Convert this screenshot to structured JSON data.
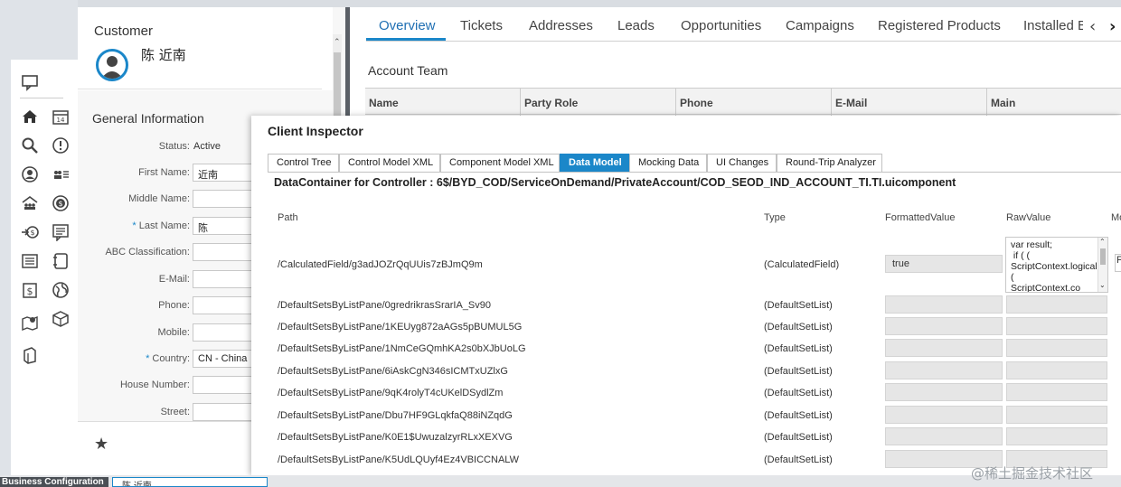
{
  "customer": {
    "title": "Customer",
    "name": "陈 近南",
    "general_info_title": "General Information",
    "status_label": "Status:",
    "status_value": "Active",
    "fields": [
      {
        "label": "First Name:",
        "value": "近南",
        "required": false
      },
      {
        "label": "Middle Name:",
        "value": "",
        "required": false
      },
      {
        "label": "Last Name:",
        "value": "陈",
        "required": true
      },
      {
        "label": "ABC Classification:",
        "value": "",
        "required": false
      },
      {
        "label": "E-Mail:",
        "value": "",
        "required": false
      },
      {
        "label": "Phone:",
        "value": "",
        "required": false
      },
      {
        "label": "Mobile:",
        "value": "",
        "required": false
      },
      {
        "label": "Country:",
        "value": "CN - China",
        "required": true
      },
      {
        "label": "House Number:",
        "value": "",
        "required": false
      },
      {
        "label": "Street:",
        "value": "",
        "required": false
      }
    ],
    "required_marker": "*",
    "favorite_icon": "★"
  },
  "tabs": [
    "Overview",
    "Tickets",
    "Addresses",
    "Leads",
    "Opportunities",
    "Campaigns",
    "Registered Products",
    "Installed B"
  ],
  "tab_nav": {
    "prev": "‹",
    "next": "›"
  },
  "account_team": {
    "title": "Account Team",
    "columns": [
      "Name",
      "Party Role",
      "Phone",
      "E-Mail",
      "Main"
    ]
  },
  "inspector": {
    "title": "Client Inspector",
    "tabs": [
      "Control Tree",
      "Control Model XML",
      "Component Model XML",
      "Data Model",
      "Mocking Data",
      "UI Changes",
      "Round-Trip Analyzer"
    ],
    "active_tab": "Data Model",
    "data_container_title": "DataContainer for Controller : 6$/BYD_COD/ServiceOnDemand/PrivateAccount/COD_SEOD_IND_ACCOUNT_TI.TI.uicomponent",
    "columns": [
      "Path",
      "Type",
      "FormattedValue",
      "RawValue",
      "Mo"
    ],
    "rows": [
      {
        "path": "/CalculatedField/g3adJOZrQqUUis7zBJmQ9m",
        "type": "(CalculatedField)",
        "formatted": "true",
        "raw": "var result;\n if ( (\nScriptContext.logicalOr( (\nScriptContext.co"
      },
      {
        "path": "/DefaultSetsByListPane/0gredrikrasSrarIA_Sv90",
        "type": "(DefaultSetList)",
        "formatted": "",
        "raw": ""
      },
      {
        "path": "/DefaultSetsByListPane/1KEUyg872aAGs5pBUMUL5G",
        "type": "(DefaultSetList)",
        "formatted": "",
        "raw": ""
      },
      {
        "path": "/DefaultSetsByListPane/1NmCeGQmhKA2s0bXJbUoLG",
        "type": "(DefaultSetList)",
        "formatted": "",
        "raw": ""
      },
      {
        "path": "/DefaultSetsByListPane/6iAskCgN346sICMTxUZlxG",
        "type": "(DefaultSetList)",
        "formatted": "",
        "raw": ""
      },
      {
        "path": "/DefaultSetsByListPane/9qK4rolyT4cUKelDSydlZm",
        "type": "(DefaultSetList)",
        "formatted": "",
        "raw": ""
      },
      {
        "path": "/DefaultSetsByListPane/Dbu7HF9GLqkfaQ88iNZqdG",
        "type": "(DefaultSetList)",
        "formatted": "",
        "raw": ""
      },
      {
        "path": "/DefaultSetsByListPane/K0E1$UwuzalzyrRLxXEXVG",
        "type": "(DefaultSetList)",
        "formatted": "",
        "raw": ""
      },
      {
        "path": "/DefaultSetsByListPane/K5UdLQUyf4Ez4VBICCNALW",
        "type": "(DefaultSetList)",
        "formatted": "",
        "raw": ""
      }
    ],
    "mo_partial": "F"
  },
  "bottom_bar": {
    "item1": "Business Configuration",
    "item2": "陈 近南"
  },
  "watermark": "@稀土掘金技术社区",
  "colors": {
    "accent": "#1b87c9",
    "dark_sep": "#5a5f66"
  },
  "rail_icons": [
    "chat-icon",
    "home-icon",
    "calendar-icon",
    "search-icon",
    "alert-icon",
    "person-icon",
    "group-list-icon",
    "org-icon",
    "money-icon",
    "transfer-money-icon",
    "comment-money-icon",
    "list-icon",
    "document-icon",
    "dollar-doc-icon",
    "globe-icon",
    "map-icon",
    "box-icon",
    "book-icon"
  ]
}
